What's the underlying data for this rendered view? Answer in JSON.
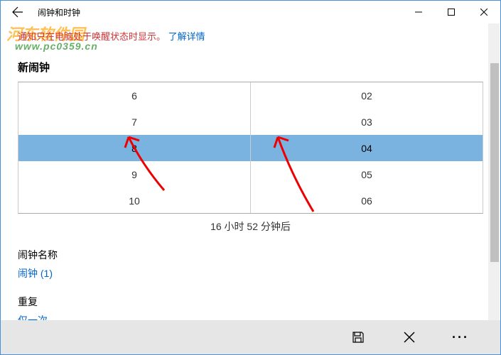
{
  "window": {
    "title": "闹钟和时钟"
  },
  "notice": {
    "text": "通知只在电脑处于唤醒状态时显示。",
    "link": "了解详情"
  },
  "watermark": {
    "line1": "河东软件园",
    "line2": "www.pc0359.cn"
  },
  "newAlarm": {
    "title": "新闹钟"
  },
  "picker": {
    "hours": [
      "6",
      "7",
      "8",
      "9",
      "10"
    ],
    "minutes": [
      "02",
      "03",
      "04",
      "05",
      "06"
    ],
    "selectedHourIndex": 2,
    "selectedMinuteIndex": 2
  },
  "timeAfter": "16 小时 52 分钟后",
  "alarmName": {
    "label": "闹钟名称",
    "value": "闹钟 (1)"
  },
  "repeat": {
    "label": "重复",
    "value": "仅一次"
  }
}
